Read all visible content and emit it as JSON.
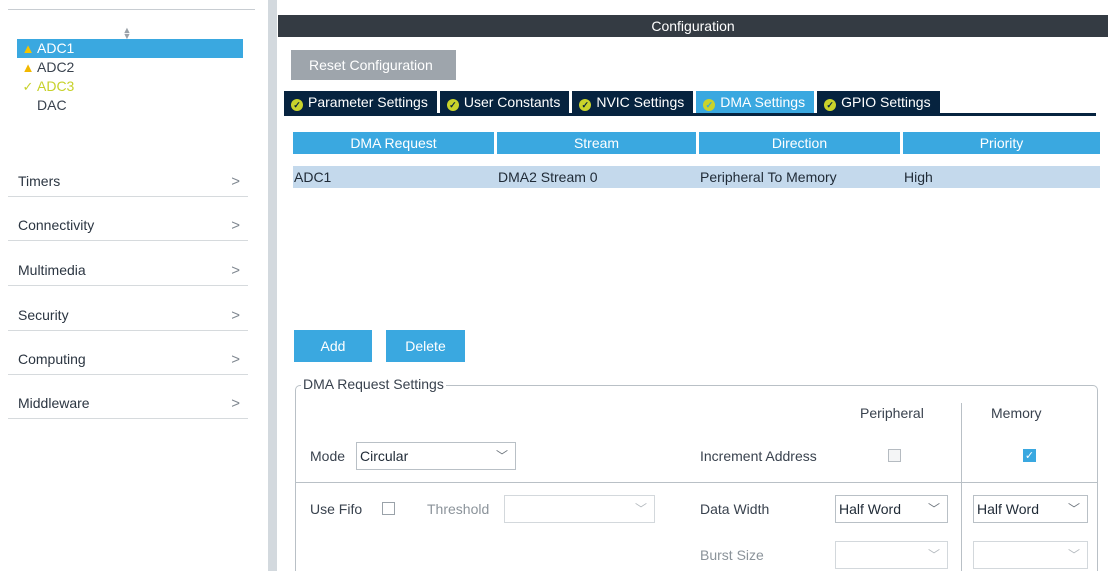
{
  "left_panel": {
    "peripherals": [
      {
        "label": "ADC1",
        "status": "warning",
        "selected": true
      },
      {
        "label": "ADC2",
        "status": "warning",
        "selected": false
      },
      {
        "label": "ADC3",
        "status": "ok",
        "selected": false
      },
      {
        "label": "DAC",
        "status": "none",
        "selected": false
      }
    ],
    "categories": [
      {
        "label": "Timers"
      },
      {
        "label": "Connectivity"
      },
      {
        "label": "Multimedia"
      },
      {
        "label": "Security"
      },
      {
        "label": "Computing"
      },
      {
        "label": "Middleware"
      }
    ]
  },
  "config": {
    "title": "Configuration",
    "reset_label": "Reset Configuration",
    "tabs": [
      {
        "label": "Parameter Settings",
        "active": false
      },
      {
        "label": "User Constants",
        "active": false
      },
      {
        "label": "NVIC Settings",
        "active": false
      },
      {
        "label": "DMA Settings",
        "active": true
      },
      {
        "label": "GPIO Settings",
        "active": false
      }
    ],
    "table": {
      "headers": [
        "DMA Request",
        "Stream",
        "Direction",
        "Priority"
      ],
      "rows": [
        [
          "ADC1",
          "DMA2 Stream 0",
          "Peripheral To Memory",
          "High"
        ]
      ]
    },
    "add_label": "Add",
    "delete_label": "Delete",
    "request_settings": {
      "legend": "DMA Request Settings",
      "peripheral_header": "Peripheral",
      "memory_header": "Memory",
      "mode_label": "Mode",
      "mode_value": "Circular",
      "increment_label": "Increment Address",
      "increment_peripheral": false,
      "increment_memory": true,
      "use_fifo_label": "Use Fifo",
      "use_fifo": false,
      "threshold_label": "Threshold",
      "threshold_value": "",
      "data_width_label": "Data Width",
      "data_width_peripheral": "Half Word",
      "data_width_memory": "Half Word",
      "burst_size_label": "Burst Size",
      "burst_peripheral": "",
      "burst_memory": ""
    }
  },
  "colors": {
    "accent": "#3aa8e0",
    "tab_dark": "#06233f",
    "title_bar": "#343b43",
    "row_selected": "#c4d9ec",
    "warning": "#f2b800",
    "ok": "#c7d12a"
  }
}
